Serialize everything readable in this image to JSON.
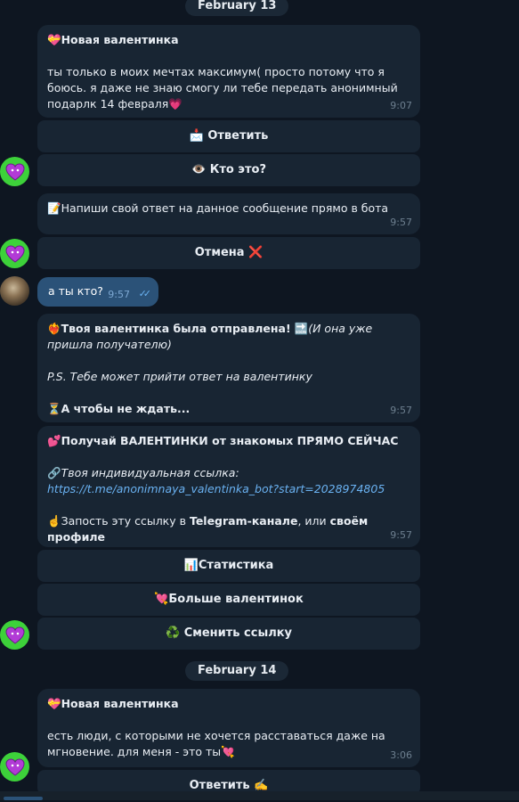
{
  "dates": {
    "feb13": "February 13",
    "feb14": "February 14"
  },
  "messages": {
    "m1": {
      "title_emoji": "💝",
      "title": "Новая валентинка",
      "text": "ты только в моих мечтах максимум( просто потому что я боюсь. я даже не знаю смогу ли тебе передать анонимный подарлк 14 февраля",
      "text_emoji": "💗",
      "time": "9:07"
    },
    "m1_buttons": {
      "reply_emoji": "📩",
      "reply": "Ответить",
      "who_emoji": "👁️",
      "who": "Кто это?"
    },
    "m2": {
      "emoji": "📝",
      "text": "Напиши свой ответ на данное сообщение прямо в бота",
      "time": "9:57"
    },
    "m2_buttons": {
      "cancel": "Отмена",
      "cancel_emoji": "❌"
    },
    "out": {
      "text": "а ты кто?",
      "time": "9:57",
      "status_icon": "double-check-icon"
    },
    "m3": {
      "emoji": "❤️‍🔥",
      "title": "Твоя валентинка была отправлена!",
      "arrow_emoji": "🔜",
      "note": "(И она уже пришла получателю)",
      "ps": "P.S. Тебе может прийти ответ на валентинку",
      "wait_emoji": "⏳",
      "wait": "А чтобы не ждать...",
      "time": "9:57"
    },
    "m4": {
      "emoji": "💕",
      "title": "Получай ВАЛЕНТИНКИ от знакомых ПРЯМО СЕЙЧАС",
      "link_emoji": "🔗",
      "link_label": "Твоя индивидуальная ссылка:",
      "link": "https://t.me/anonimnaya_valentinka_bot?start=2028974805",
      "hint_emoji": "☝️",
      "hint_pre": "Запость эту ссылку в ",
      "hint_bold1": "Telegram-канале",
      "hint_mid": ", или ",
      "hint_bold2": "своём профиле",
      "time": "9:57"
    },
    "m4_buttons": {
      "stats_emoji": "📊",
      "stats": "Статистика",
      "more_emoji": "💘",
      "more": "Больше валентинок",
      "change_emoji": "♻️",
      "change": "Сменить ссылку"
    },
    "m5": {
      "title_emoji": "💝",
      "title": "Новая валентинка",
      "text": "есть люди, с которыми не хочется расставаться даже на мгновение. для меня - это ты",
      "text_emoji": "💘",
      "time": "3:06"
    },
    "m5_buttons": {
      "reply": "Ответить",
      "reply_emoji": "✍️"
    }
  },
  "colors": {
    "bg": "#0e1621",
    "bubble": "#182533",
    "outgoing": "#2b5278",
    "avatar": "#3dd13a",
    "link": "#6ab2f2"
  }
}
